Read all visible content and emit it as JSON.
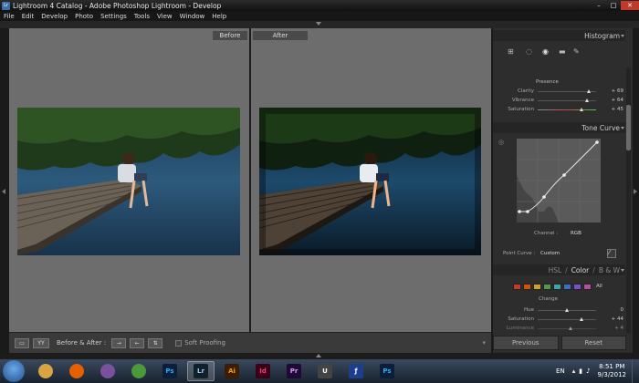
{
  "window": {
    "title": "Lightroom 4 Catalog - Adobe Photoshop Lightroom - Develop",
    "logo": "Lr"
  },
  "menu": [
    "File",
    "Edit",
    "Develop",
    "Photo",
    "Settings",
    "Tools",
    "View",
    "Window",
    "Help"
  ],
  "compare": {
    "before_label": "Before",
    "after_label": "After"
  },
  "toolbar": {
    "view_yy": "YY",
    "before_after_label": "Before & After :",
    "soft_proofing_label": "Soft Proofing"
  },
  "panels": {
    "histogram_title": "Histogram",
    "presence_title": "Presence",
    "sliders": [
      {
        "label": "Clarity",
        "value": "+ 69",
        "position": 0.85
      },
      {
        "label": "Vibrance",
        "value": "+ 64",
        "position": 0.82
      },
      {
        "label": "Saturation",
        "value": "+ 45",
        "position": 0.73
      }
    ],
    "tone_curve_title": "Tone Curve",
    "channel_label": "Channel :",
    "channel_value": "RGB",
    "point_curve_label": "Point Curve :",
    "point_curve_value": "Custom",
    "hsl_tabs": [
      "HSL",
      "/",
      "Color",
      "/",
      "B & W"
    ],
    "hsl_all": "All",
    "hsl_swatches": [
      "#c0392b",
      "#d35400",
      "#c9a227",
      "#4e9a4e",
      "#3aa6a6",
      "#3a6fc9",
      "#7a4fc9",
      "#b04fa0"
    ],
    "change_label": "Change",
    "hsl_rows": [
      {
        "label": "Hue",
        "value": "0"
      },
      {
        "label": "Saturation",
        "value": "+ 44"
      },
      {
        "label": "Luminance",
        "value": "+ 4"
      }
    ]
  },
  "buttons": {
    "previous": "Previous",
    "reset": "Reset"
  },
  "taskbar": {
    "apps": [
      {
        "name": "file-explorer",
        "label": "",
        "color": "#d9a441",
        "text_color": "#fff"
      },
      {
        "name": "firefox",
        "label": "",
        "color": "#e66000",
        "text_color": "#fff"
      },
      {
        "name": "viber",
        "label": "",
        "color": "#7b519d",
        "text_color": "#fff"
      },
      {
        "name": "chrome",
        "label": "",
        "color": "#4a9a3a",
        "text_color": "#fff"
      },
      {
        "name": "photoshop",
        "label": "Ps",
        "color": "#0b1f3b",
        "text_color": "#31a8ff"
      },
      {
        "name": "lightroom",
        "label": "Lr",
        "color": "#10202b",
        "text_color": "#9ec6e8",
        "active": true
      },
      {
        "name": "illustrator",
        "label": "Ai",
        "color": "#3b1d00",
        "text_color": "#ff9a00"
      },
      {
        "name": "indesign",
        "label": "Id",
        "color": "#3a0015",
        "text_color": "#ff3680"
      },
      {
        "name": "premiere",
        "label": "Pr",
        "color": "#1e0a35",
        "text_color": "#d49bff"
      },
      {
        "name": "uin",
        "label": "U",
        "color": "#444",
        "text_color": "#fff"
      },
      {
        "name": "flash",
        "label": "ƒ",
        "color": "#1c3e8c",
        "text_color": "#fff"
      },
      {
        "name": "photoshop-2",
        "label": "Ps",
        "color": "#0b1f3b",
        "text_color": "#31a8ff"
      }
    ],
    "language": "EN",
    "time": "8:51 PM",
    "date": "9/3/2012"
  }
}
